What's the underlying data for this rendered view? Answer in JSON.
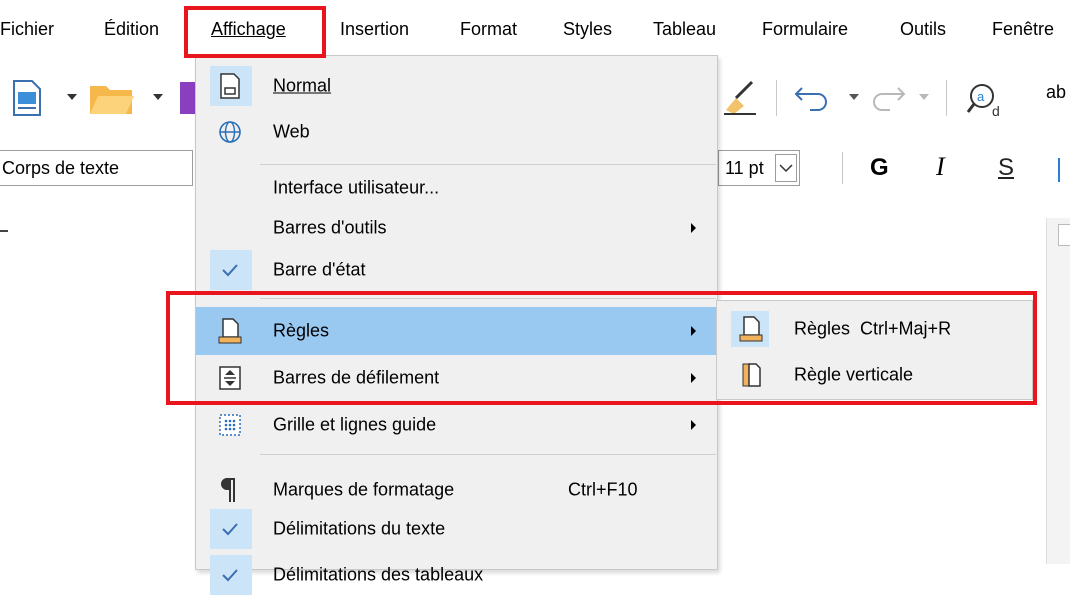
{
  "menubar": {
    "items": [
      {
        "label": "Fichier"
      },
      {
        "label": "Édition"
      },
      {
        "label": "Affichage"
      },
      {
        "label": "Insertion"
      },
      {
        "label": "Format"
      },
      {
        "label": "Styles"
      },
      {
        "label": "Tableau"
      },
      {
        "label": "Formulaire"
      },
      {
        "label": "Outils"
      },
      {
        "label": "Fenêtre"
      }
    ]
  },
  "toolbar": {
    "paragraph_style": "Corps de texte",
    "font_size": "11 pt",
    "bold": "G",
    "italic": "I",
    "underline": "S",
    "ab": "ab"
  },
  "view_menu": {
    "items": [
      {
        "label": "Normal"
      },
      {
        "label": "Web"
      },
      {
        "label": "Interface utilisateur..."
      },
      {
        "label": "Barres d'outils"
      },
      {
        "label": "Barre d'état"
      },
      {
        "label": "Règles"
      },
      {
        "label": "Barres de défilement"
      },
      {
        "label": "Grille et lignes guide"
      },
      {
        "label": "Marques de formatage",
        "shortcut": "Ctrl+F10"
      },
      {
        "label": "Délimitations du texte"
      },
      {
        "label": "Délimitations des tableaux"
      }
    ]
  },
  "rulers_submenu": {
    "items": [
      {
        "label": "Règles",
        "shortcut": "Ctrl+Maj+R"
      },
      {
        "label": "Règle verticale"
      }
    ]
  },
  "colors": {
    "highlight_red": "#e8141e",
    "hover_blue": "#99c9f1",
    "check_blue": "#cce4f7",
    "menu_bg": "#f0f0f0"
  }
}
